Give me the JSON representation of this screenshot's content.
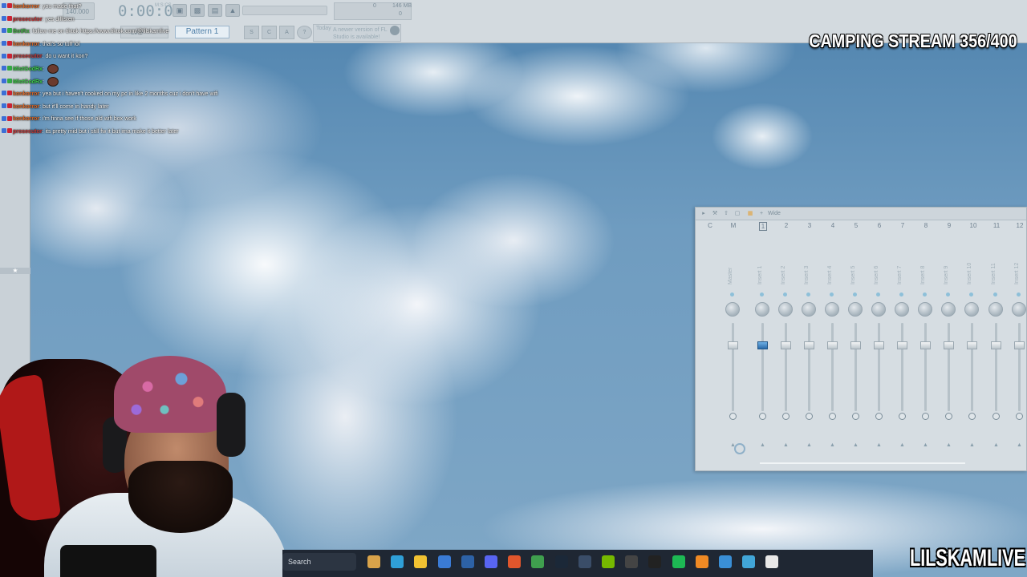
{
  "toolbar": {
    "tempo": "140.000",
    "time": "0:00:00",
    "time_unit": "M:S:CS",
    "cpu": "0",
    "memory": "146 MB",
    "polyphony": "0",
    "snap_mode": "Line",
    "pattern": "Pattern 1",
    "news_day": "Today",
    "news_text": "A newer version of FL Studio is available!"
  },
  "chat": [
    {
      "name": "konkorror",
      "text": ": you made that?",
      "badges": [
        "blue",
        "red"
      ],
      "emote": false
    },
    {
      "name": "prosecutor",
      "text": ": yes dillisten",
      "badges": [
        "blue",
        "red"
      ],
      "emote": false
    },
    {
      "name": "BotRx",
      "text": ": follow me on tiktok https://www.tiktok.com/@lilskamlive",
      "badges": [
        "blue",
        "green"
      ],
      "emote": false
    },
    {
      "name": "konkorror",
      "text": ": that's so tuff lol",
      "badges": [
        "blue",
        "red"
      ],
      "emote": false
    },
    {
      "name": "prosecutor",
      "text": ": do u want it kon?",
      "badges": [
        "blue",
        "red"
      ],
      "emote": false
    },
    {
      "name": "MistGodRx",
      "text": ":",
      "badges": [
        "blue",
        "green"
      ],
      "emote": true
    },
    {
      "name": "MistGodRx",
      "text": ":",
      "badges": [
        "blue",
        "green"
      ],
      "emote": true
    },
    {
      "name": "konkorror",
      "text": ": yea but i haven't cooked on my pc in like 2 months cuz i don't have wifi",
      "badges": [
        "blue",
        "red"
      ],
      "emote": false
    },
    {
      "name": "konkorror",
      "text": ": but it'll come in handy later",
      "badges": [
        "blue",
        "red"
      ],
      "emote": false
    },
    {
      "name": "konkorror",
      "text": ": i'm finna see if those old wifi box work",
      "badges": [
        "blue",
        "red"
      ],
      "emote": false
    },
    {
      "name": "prosecutor",
      "text": ": its pretty mid but i still fw it but ima make it better later",
      "badges": [
        "blue",
        "red"
      ],
      "emote": false
    }
  ],
  "stream_title": "CAMPING STREAM 356/400",
  "watermark": "LILSKAMLIVE",
  "mixer": {
    "preset": "Wide",
    "channel_numbers": [
      "C",
      "M",
      "1",
      "2",
      "3",
      "4",
      "5",
      "6",
      "7",
      "8",
      "9",
      "10",
      "11",
      "12"
    ],
    "strips": [
      "Master",
      "Insert 1",
      "Insert 2",
      "Insert 3",
      "Insert 4",
      "Insert 5",
      "Insert 6",
      "Insert 7",
      "Insert 8",
      "Insert 9",
      "Insert 10",
      "Insert 11",
      "Insert 12"
    ],
    "active_strip": "Insert 1"
  },
  "taskbar": {
    "search_placeholder": "Search",
    "icons": [
      "copilot-icon",
      "edge-icon",
      "file-explorer-icon",
      "store-icon",
      "photoshop-icon",
      "discord-icon",
      "brave-icon",
      "chrome-icon",
      "steam-icon",
      "app-icon",
      "nvidia-icon",
      "4k-icon",
      "capcut-icon",
      "spotify-icon",
      "fl-studio-icon",
      "notepad-icon",
      "photos-icon",
      "file-icon"
    ]
  }
}
